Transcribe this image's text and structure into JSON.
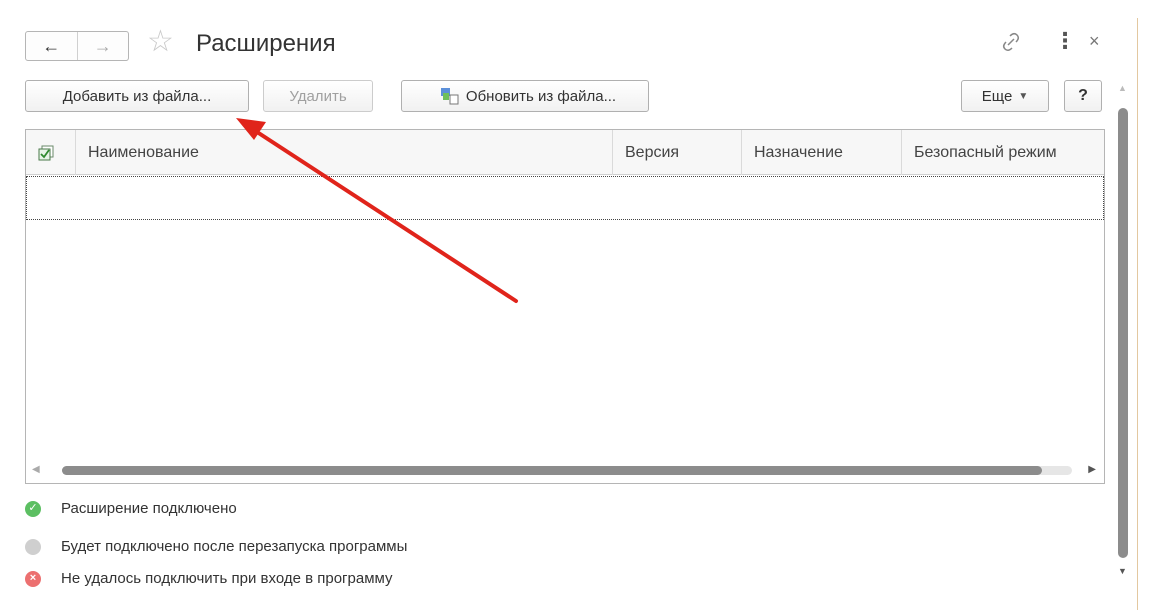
{
  "header": {
    "back_icon": "arrow-left-icon",
    "forward_icon": "arrow-right-icon",
    "title": "Расширения",
    "favorite_icon": "star-icon",
    "link_icon": "link-icon",
    "more_icon": "more-vertical-icon",
    "close_icon": "close-icon"
  },
  "toolbar": {
    "add_label": "Добавить из файла...",
    "delete_label": "Удалить",
    "update_label": "Обновить из файла...",
    "more_label": "Еще",
    "help_label": "?"
  },
  "table": {
    "columns": [
      "Наименование",
      "Версия",
      "Назначение",
      "Безопасный режим"
    ],
    "rows": []
  },
  "legend": [
    {
      "text": "Расширение подключено",
      "color": "#5cbf62",
      "icon": "check-circle-icon"
    },
    {
      "text": "Будет подключено после перезапуска программы",
      "color": "#cfcfcf",
      "icon": "gray-circle-icon"
    },
    {
      "text": "Не удалось подключить при входе в программу",
      "color": "#ec7070",
      "icon": "error-circle-icon"
    }
  ],
  "annotation": {
    "color": "#e0241b"
  }
}
